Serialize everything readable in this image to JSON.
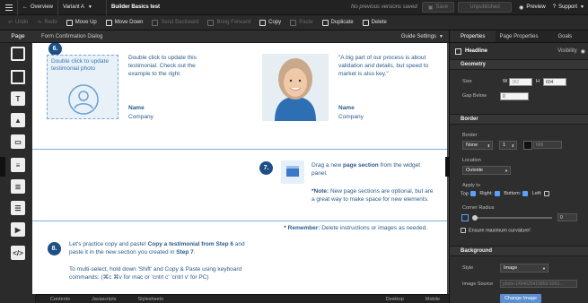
{
  "topbar": {
    "back_icon": "hamburger-icon",
    "overview": "Overview",
    "variant": "Variant A",
    "title": "Builder Basics test",
    "status": "No previous versions saved",
    "save": "Save",
    "unpublished": "Unpublished",
    "preview": "Preview",
    "support": "Support"
  },
  "toolbar": {
    "undo": "Undo",
    "redo": "Redo",
    "move_up": "Move Up",
    "move_down": "Move Down",
    "send_backward": "Send Backward",
    "bring_forward": "Bring Forward",
    "copy": "Copy",
    "paste": "Paste",
    "duplicate": "Duplicate",
    "delete": "Delete"
  },
  "tabs": {
    "page": "Page",
    "dialog": "Form Confirmation Dialog",
    "guide": "Guide Settings"
  },
  "canvas": {
    "step6": "6.",
    "placeholder_text": "Double click to update testimonial photo",
    "testimonial_text": "Double click to update this testimonial. Check out the example to the right.",
    "name1": "Name",
    "company1": "Company",
    "quote": "\"A big part of our process is about validation and details, but speed to market is also key.\"",
    "name2": "Name",
    "company2": "Company",
    "step7": "7.",
    "drag_pre": "Drag a new ",
    "drag_bold": "page section",
    "drag_post": " from the widget panel.",
    "note_bold": "*Note:",
    "note_text": " New page sections are optional, but are a great way to make space for new elements.",
    "remember_bold": "* Remember:",
    "remember_text": " Delete instructions or images as needed.",
    "step8": "8.",
    "practice_pre": "Let's practice copy and paste! ",
    "practice_bold": "Copy a testimonial from Step 6",
    "practice_mid": " and paste it in the new section you created in ",
    "practice_bold2": "Step 7",
    "practice_end": ".",
    "multi": "To multi-select, hold down 'Shift' and Copy & Paste using keyboard commands: (⌘c ⌘v for mac or 'cntrl c' 'cntrl v' for PC)"
  },
  "bottombar": {
    "contents": "Contents",
    "javascripts": "Javascripts",
    "stylesheets": "Stylesheets",
    "desktop": "Desktop",
    "mobile": "Mobile"
  },
  "right_panel": {
    "tabs": [
      "Properties",
      "Page Properties",
      "Goals"
    ],
    "headline": "Headline",
    "visibility": "Visibility",
    "geometry": "Geometry",
    "size": "Size",
    "w_label": "W",
    "w_value": "382",
    "h_label": "H",
    "h_value": "604",
    "gap_below": "Gap Below",
    "gap_value": "0",
    "border": "Border",
    "border_label": "Border",
    "border_style": "None",
    "border_width": "1",
    "border_color": "666",
    "location": "Location",
    "location_value": "Outside",
    "apply_to": "Apply to",
    "top": "Top",
    "right": "Right:",
    "bottom": "Bottom:",
    "left": "Left:",
    "corner_radius": "Corner Radius",
    "corner_value": "0",
    "ensure_curvature": "Ensure maximum curvature!",
    "background": "Background",
    "style": "Style",
    "style_value": "Image",
    "image_source": "Image Source",
    "image_value": "photo-1464025415853-5263...",
    "change_image": "Change Image"
  },
  "colors": {
    "accent": "#1d4f86",
    "blue_text": "#2a5a8a",
    "guide": "#7bb0e0"
  }
}
